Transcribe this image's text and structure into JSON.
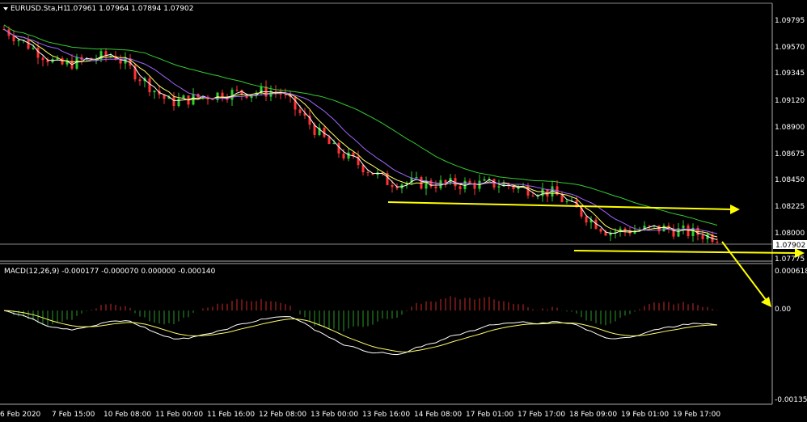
{
  "window": {
    "symbol_label": "EURUSD.Sta,H1",
    "ohlc": "1.07961 1.07964 1.07894 1.07902",
    "current_price": "1.07902"
  },
  "price_axis": {
    "ticks": [
      "1.09795",
      "1.09570",
      "1.09345",
      "1.09120",
      "1.08900",
      "1.08675",
      "1.08450",
      "1.08225",
      "1.08000",
      "1.07775"
    ],
    "current_price": "1.07902"
  },
  "indicator": {
    "label": "MACD(12,26,9) -0.000177 -0.000070 0.000000 -0.000140",
    "ticks": [
      "0.000618",
      "0.00",
      "-0.00135"
    ]
  },
  "time_axis": {
    "ticks": [
      "6 Feb 2020",
      "7 Feb 15:00",
      "10 Feb 08:00",
      "11 Feb 00:00",
      "11 Feb 16:00",
      "12 Feb 08:00",
      "13 Feb 00:00",
      "13 Feb 16:00",
      "14 Feb 08:00",
      "17 Feb 01:00",
      "17 Feb 17:00",
      "18 Feb 09:00",
      "19 Feb 01:00",
      "19 Feb 17:00"
    ]
  },
  "colors": {
    "background": "#000000",
    "bull": "#32cd32",
    "bear": "#ff3333",
    "ma_fast": "#ffffff",
    "ma_mid": "#ffff66",
    "ma_slow": "#a066ff",
    "ma_long": "#33cc33",
    "annotation": "#ffff00",
    "hist_pos": "#cc2a2a",
    "hist_neg": "#2a9a2a"
  },
  "chart_data": {
    "type": "line",
    "price_range": [
      1.0772,
      1.1
    ],
    "macd_range": [
      -0.00135,
      0.000618
    ],
    "series": [
      {
        "name": "EURUSD.Sta,H1",
        "x": [
          "6 Feb 2020",
          "7 Feb 15:00",
          "10 Feb 08:00",
          "11 Feb 00:00",
          "11 Feb 16:00",
          "12 Feb 08:00",
          "13 Feb 00:00",
          "13 Feb 16:00",
          "14 Feb 08:00",
          "17 Feb 01:00",
          "17 Feb 17:00",
          "18 Feb 09:00",
          "19 Feb 01:00",
          "19 Feb 17:00"
        ],
        "values": [
          1.0978,
          1.0945,
          1.0955,
          1.0912,
          1.092,
          1.0922,
          1.087,
          1.084,
          1.0838,
          1.0838,
          1.083,
          1.0795,
          1.0798,
          1.079
        ]
      }
    ]
  }
}
